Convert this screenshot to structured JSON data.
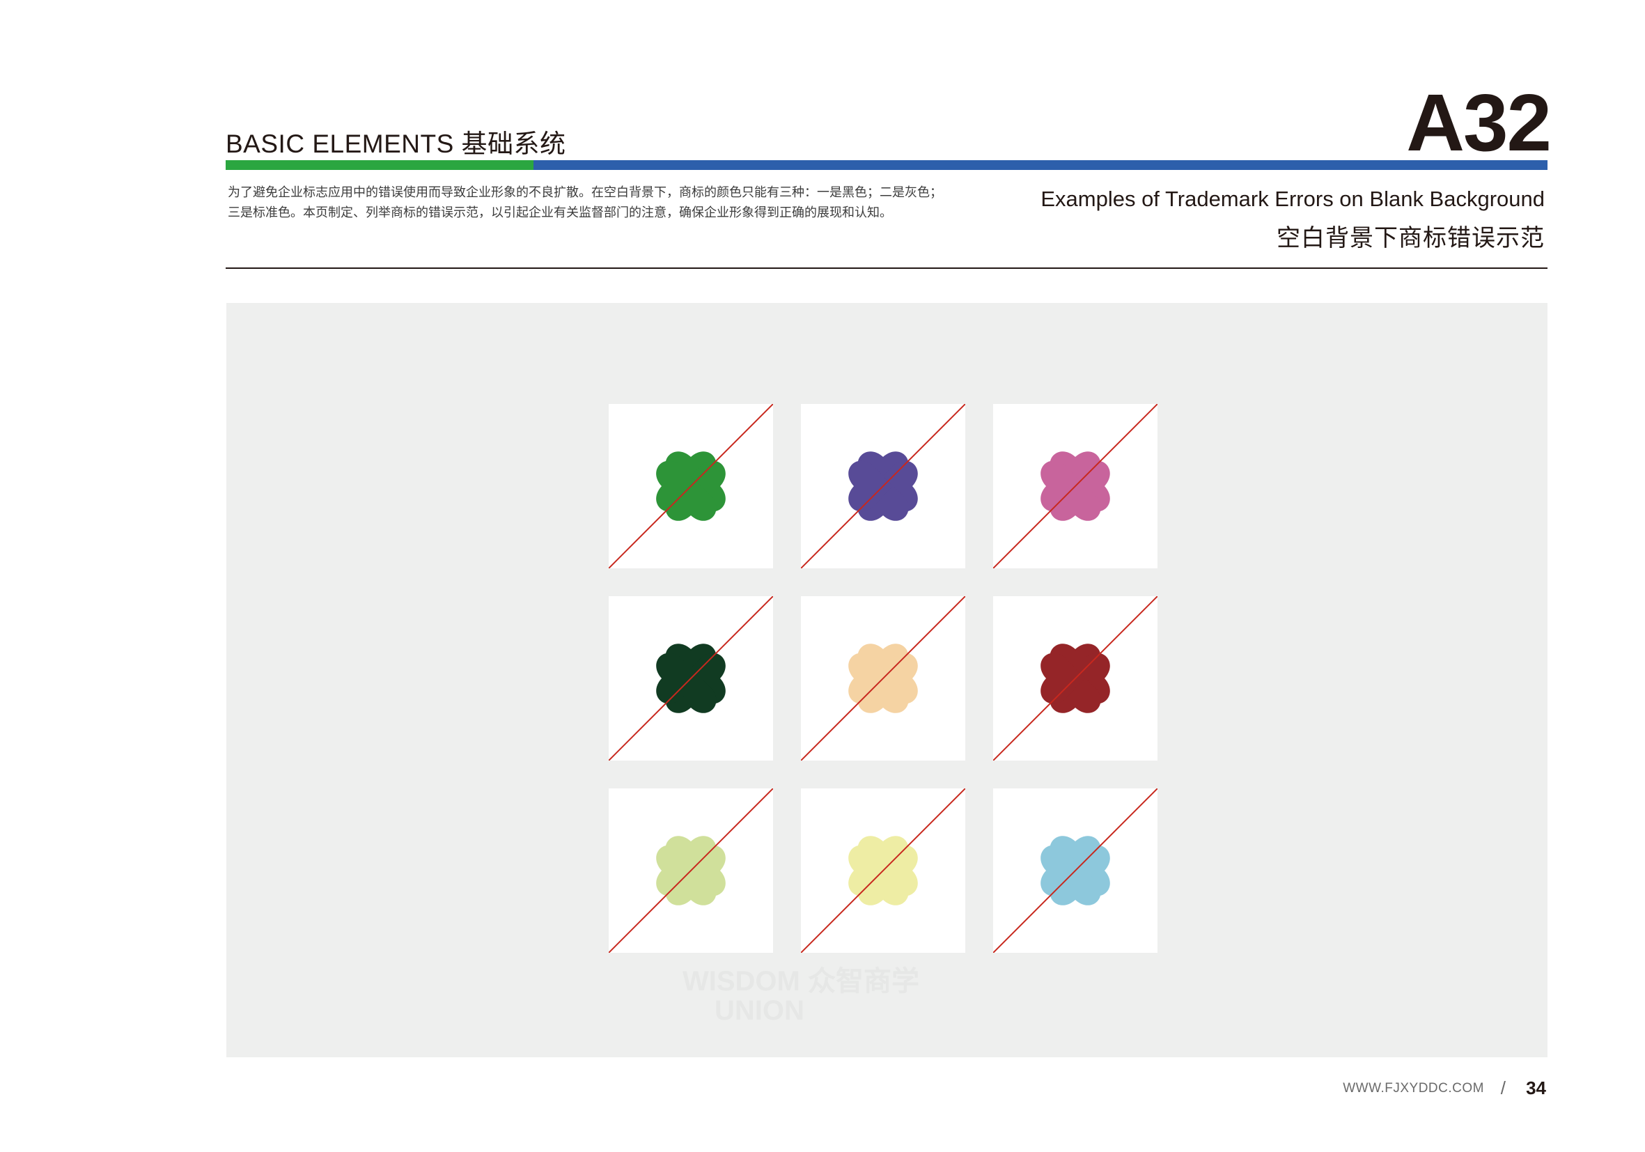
{
  "header": {
    "section_title": "BASIC ELEMENTS 基础系统",
    "page_code": "A32",
    "description_line1": "为了避免企业标志应用中的错误使用而导致企业形象的不良扩散。在空白背景下，商标的颜色只能有三种：一是黑色；二是灰色；",
    "description_line2": "三是标准色。本页制定、列举商标的错误示范，以引起企业有关监督部门的注意，确保企业形象得到正确的展现和认知。",
    "title_en": "Examples of Trademark Errors on Blank Background",
    "title_cn": "空白背景下商标错误示范"
  },
  "colors": {
    "green_bar": "#2ba640",
    "blue_bar": "#2d5fab",
    "panel_bg": "#eeefee",
    "error_line": "#c8281e"
  },
  "examples": [
    {
      "color": "#2d9438",
      "icon": "clover-logo-icon"
    },
    {
      "color": "#584b97",
      "icon": "clover-logo-icon"
    },
    {
      "color": "#c8649c",
      "icon": "clover-logo-icon"
    },
    {
      "color": "#113b22",
      "icon": "clover-logo-icon"
    },
    {
      "color": "#f5d3a3",
      "icon": "clover-logo-icon"
    },
    {
      "color": "#952528",
      "icon": "clover-logo-icon"
    },
    {
      "color": "#d0e09b",
      "icon": "clover-logo-icon"
    },
    {
      "color": "#eeeda4",
      "icon": "clover-logo-icon"
    },
    {
      "color": "#8dc8dc",
      "icon": "clover-logo-icon"
    }
  ],
  "watermark": {
    "line1": "WISDOM 众智商学",
    "line2": "UNION"
  },
  "footer": {
    "url": "WWW.FJXYDDC.COM",
    "separator": "/",
    "page_number": "34"
  }
}
